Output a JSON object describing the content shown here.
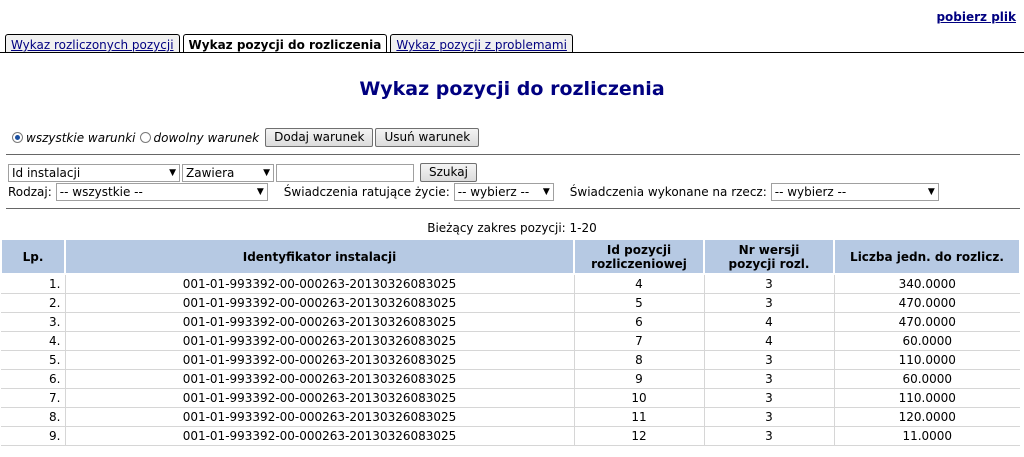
{
  "header": {
    "download_link": "pobierz plik"
  },
  "tabs": [
    {
      "label": "Wykaz rozliczonych pozycji",
      "active": false
    },
    {
      "label": "Wykaz pozycji do rozliczenia",
      "active": true
    },
    {
      "label": "Wykaz pozycji z problemami",
      "active": false
    }
  ],
  "page_title": "Wykaz pozycji do rozliczenia",
  "conditions": {
    "all_label": "wszystkie warunki",
    "any_label": "dowolny warunek",
    "selected": "all",
    "add_button": "Dodaj warunek",
    "remove_button": "Usuń warunek"
  },
  "filter": {
    "field_select": "Id instalacji",
    "operator_select": "Zawiera",
    "value_input": "",
    "search_button": "Szukaj",
    "rodzaj_label": "Rodzaj:",
    "rodzaj_value": "-- wszystkie --",
    "ratujace_label": "Świadczenia ratujące życie:",
    "ratujace_value": "-- wybierz --",
    "wykonane_label": "Świadczenia wykonane na rzecz:",
    "wykonane_value": "-- wybierz --"
  },
  "range_text": "Bieżący zakres pozycji: 1-20",
  "table": {
    "headers": {
      "lp": "Lp.",
      "id_inst": "Identyfikator instalacji",
      "id_poz_1": "Id pozycji",
      "id_poz_2": "rozliczeniowej",
      "nr_wer_1": "Nr wersji",
      "nr_wer_2": "pozycji rozl.",
      "liczba": "Liczba jedn. do rozlicz."
    },
    "rows": [
      {
        "lp": "1.",
        "id": "001-01-993392-00-000263-20130326083025",
        "poz": "4",
        "wer": "3",
        "liczba": "340.0000"
      },
      {
        "lp": "2.",
        "id": "001-01-993392-00-000263-20130326083025",
        "poz": "5",
        "wer": "3",
        "liczba": "470.0000"
      },
      {
        "lp": "3.",
        "id": "001-01-993392-00-000263-20130326083025",
        "poz": "6",
        "wer": "4",
        "liczba": "470.0000"
      },
      {
        "lp": "4.",
        "id": "001-01-993392-00-000263-20130326083025",
        "poz": "7",
        "wer": "4",
        "liczba": "60.0000"
      },
      {
        "lp": "5.",
        "id": "001-01-993392-00-000263-20130326083025",
        "poz": "8",
        "wer": "3",
        "liczba": "110.0000"
      },
      {
        "lp": "6.",
        "id": "001-01-993392-00-000263-20130326083025",
        "poz": "9",
        "wer": "3",
        "liczba": "60.0000"
      },
      {
        "lp": "7.",
        "id": "001-01-993392-00-000263-20130326083025",
        "poz": "10",
        "wer": "3",
        "liczba": "110.0000"
      },
      {
        "lp": "8.",
        "id": "001-01-993392-00-000263-20130326083025",
        "poz": "11",
        "wer": "3",
        "liczba": "120.0000"
      },
      {
        "lp": "9.",
        "id": "001-01-993392-00-000263-20130326083025",
        "poz": "12",
        "wer": "3",
        "liczba": "11.0000"
      }
    ]
  }
}
